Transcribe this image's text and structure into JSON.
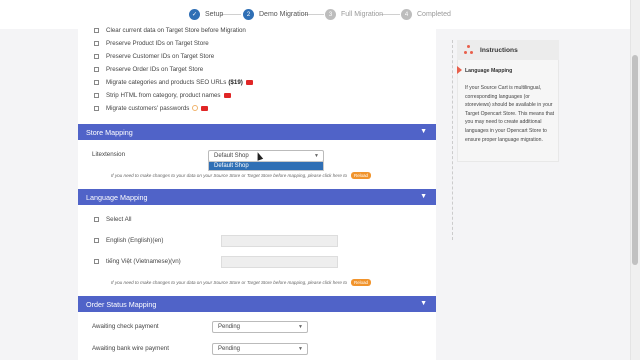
{
  "stepper": {
    "steps": [
      {
        "num": "✓",
        "label": "Setup"
      },
      {
        "num": "2",
        "label": "Demo Migration"
      },
      {
        "num": "3",
        "label": "Full Migration"
      },
      {
        "num": "4",
        "label": "Completed"
      }
    ]
  },
  "options": [
    {
      "label": "Clear current data on Target Store before Migration",
      "checked": false
    },
    {
      "label": "Preserve Product IDs on Target Store",
      "checked": false
    },
    {
      "label": "Preserve Customer IDs on Target Store",
      "checked": false
    },
    {
      "label": "Preserve Order IDs on Target Store",
      "checked": false
    },
    {
      "label": "Migrate categories and products SEO URLs",
      "price": "($19)",
      "checked": false
    },
    {
      "label": "Strip HTML from category, product names",
      "checked": false
    },
    {
      "label": "Migrate customers' passwords",
      "checked": false
    }
  ],
  "store_mapping": {
    "title": "Store Mapping",
    "source_label": "Litextension",
    "selected": "Default Shop",
    "dropdown_option": "Default Shop",
    "note": "If you need to make changes to your data on your Source Store or Target Store before mapping, please click here to",
    "reload": "Reload"
  },
  "language_mapping": {
    "title": "Language Mapping",
    "select_all": "Select All",
    "languages": [
      "English (English)(en)",
      "tiếng Việt (Vietnamese)(vn)"
    ],
    "note": "If you need to make changes to your data on your Source Store or Target Store before mapping, please click here to",
    "reload": "Reload"
  },
  "order_status_mapping": {
    "title": "Order Status Mapping",
    "rows": [
      {
        "label": "Awaiting check payment",
        "value": "Pending"
      },
      {
        "label": "Awaiting bank wire payment",
        "value": "Pending"
      }
    ]
  },
  "instructions": {
    "title": "Instructions",
    "subtitle": "Language Mapping",
    "body": "If your Source Cart is multilingual, corresponding languages (or storeviews) should be available in your Target Opencart Store. This means that you may need to create additional languages in your Opencart Store to ensure proper language migration."
  },
  "colors": {
    "section_bar": "#5063c8",
    "step_active": "#2f6fb5",
    "reload_button": "#f1942c",
    "youtube_icon": "#e02626"
  }
}
